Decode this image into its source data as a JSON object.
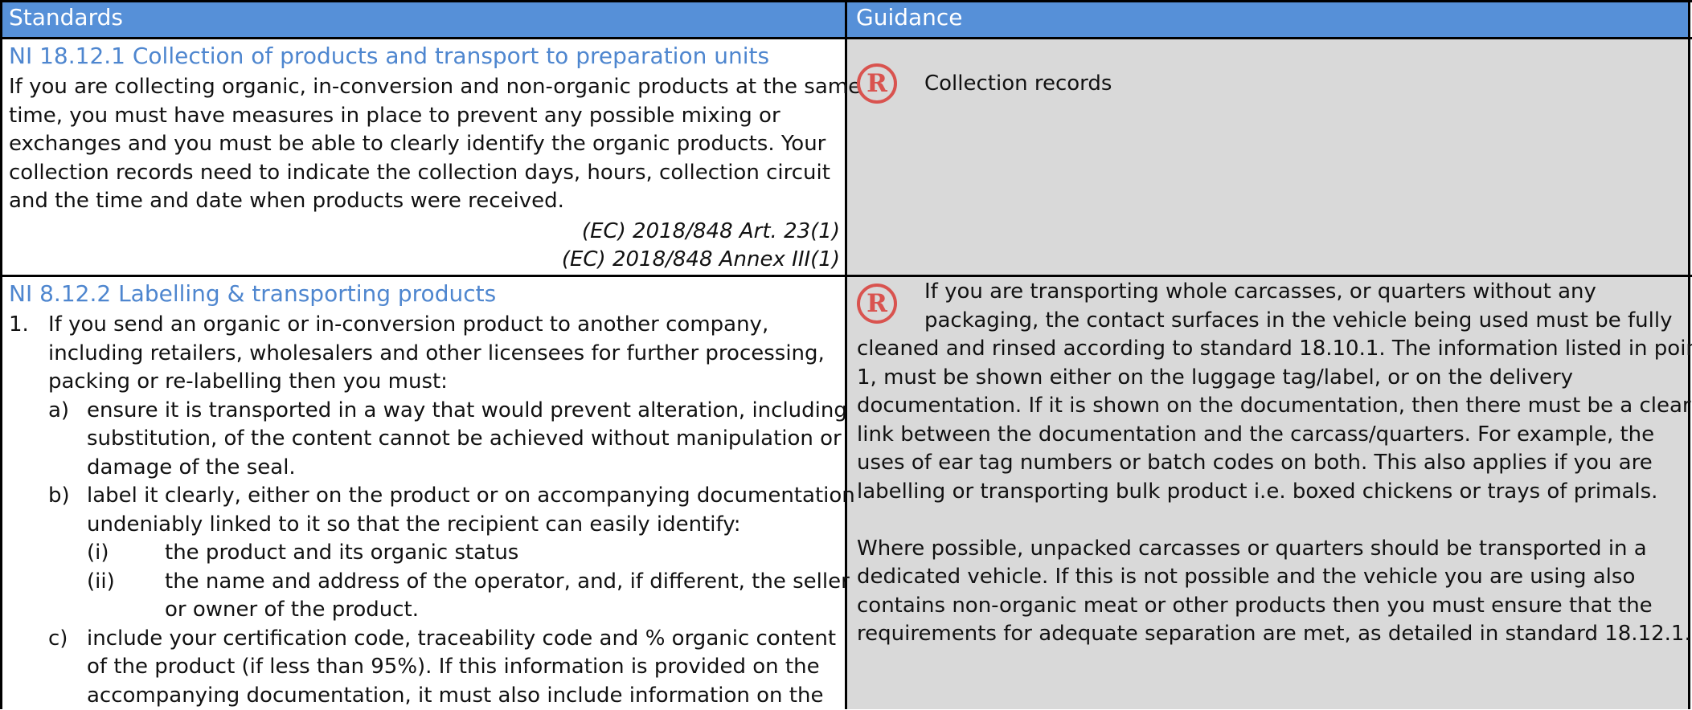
{
  "header": {
    "standards": "Standards",
    "guidance": "Guidance"
  },
  "colors": {
    "header_bg": "#5690d8",
    "title": "#4e86cf",
    "guidance_bg": "#d9d9d9",
    "icon": "#d9534f"
  },
  "icons": {
    "record": "R"
  },
  "section1": {
    "title": "NI 18.12.1 Collection of products and transport to preparation units",
    "lines": [
      "If you are collecting organic, in-conversion and non-organic products at the same",
      "time, you must have measures in place to prevent any possible mixing or",
      "exchanges and you must be able to clearly identify the organic products. Your",
      "collection records need to indicate the collection days, hours, collection circuit",
      "and the time and date when products were received."
    ],
    "refs": [
      "(EC) 2018/848 Art. 23(1)",
      "(EC) 2018/848 Annex III(1)"
    ],
    "guidance": "Collection records"
  },
  "section2": {
    "title": "NI 8.12.2 Labelling & transporting products",
    "item1": {
      "num": "1.",
      "lines": [
        "If you send an organic or in-conversion product to another company,",
        "including retailers, wholesalers and other licensees for further processing,",
        "packing or re-labelling then you must:"
      ]
    },
    "a": {
      "label": "a)",
      "lines": [
        "ensure it is transported in a way that would prevent alteration, including",
        "substitution, of the content cannot be achieved without manipulation or",
        "damage of the seal."
      ]
    },
    "b": {
      "label": "b)",
      "lines": [
        "label it clearly, either on the product or on accompanying documentation",
        "undeniably linked to it so that the recipient can easily identify:"
      ]
    },
    "i": {
      "label": "(i)",
      "text": "the product and its organic status"
    },
    "ii": {
      "label": "(ii)",
      "lines": [
        "the name and address of the operator, and, if different, the seller",
        "or owner of the product."
      ]
    },
    "c": {
      "label": "c)",
      "lines": [
        "include your certification code, traceability code and % organic content",
        "of the product (if less than 95%). If this information is provided on the",
        "accompanying documentation, it must also include information on the"
      ]
    },
    "guidance_lines": [
      "If you are transporting whole carcasses, or quarters without any",
      "packaging, the contact surfaces in the vehicle being used must be fully",
      "cleaned and rinsed according to standard 18.10.1. The information listed in point",
      "1, must be shown either on the luggage tag/label, or on the delivery",
      "documentation. If it is shown on the documentation, then there must be a clear",
      "link between the documentation and the carcass/quarters. For example, the",
      "uses of ear tag numbers or batch codes on both. This also applies if you are",
      "labelling or transporting bulk product i.e. boxed chickens or trays of primals."
    ],
    "guidance_lines2": [
      "Where possible, unpacked carcasses or quarters should be transported in a",
      "dedicated vehicle. If this is not possible and the vehicle you are using also",
      "contains non-organic meat or other products then you must ensure that the",
      "requirements for adequate separation are met, as detailed in standard 18.12.1."
    ]
  }
}
